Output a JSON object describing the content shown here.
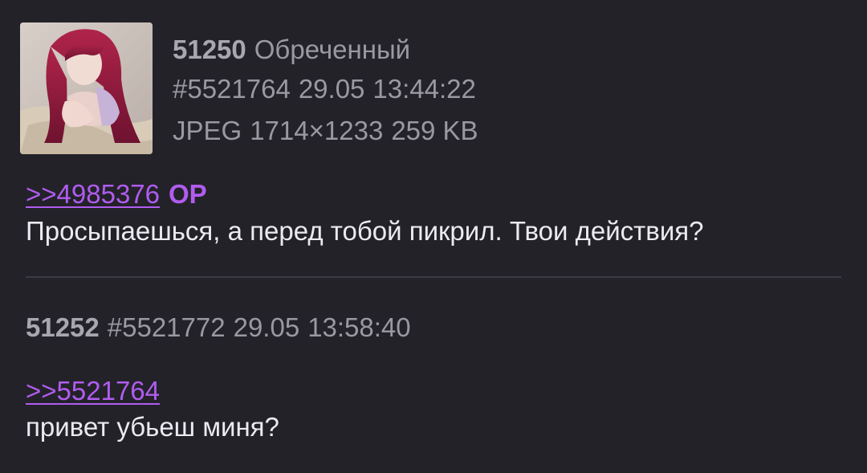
{
  "posts": [
    {
      "number": "51250",
      "name": "Обреченный",
      "id": "#5521764",
      "date": "29.05",
      "time": "13:44:22",
      "file": {
        "format": "JPEG",
        "dimensions": "1714×1233",
        "size": "259 KB"
      },
      "reply_to": ">>4985376",
      "reply_tag": "OP",
      "text": "Просыпаешься, а перед тобой пикрил. Твои действия?"
    },
    {
      "number": "51252",
      "id": "#5521772",
      "date": "29.05",
      "time": "13:58:40",
      "reply_to": ">>5521764",
      "text": "привет убьеш миня?"
    }
  ],
  "colors": {
    "background": "#232229",
    "link": "#b15cf0",
    "meta": "#9a99a2",
    "text": "#eceaf0",
    "divider": "#3c3b44"
  }
}
